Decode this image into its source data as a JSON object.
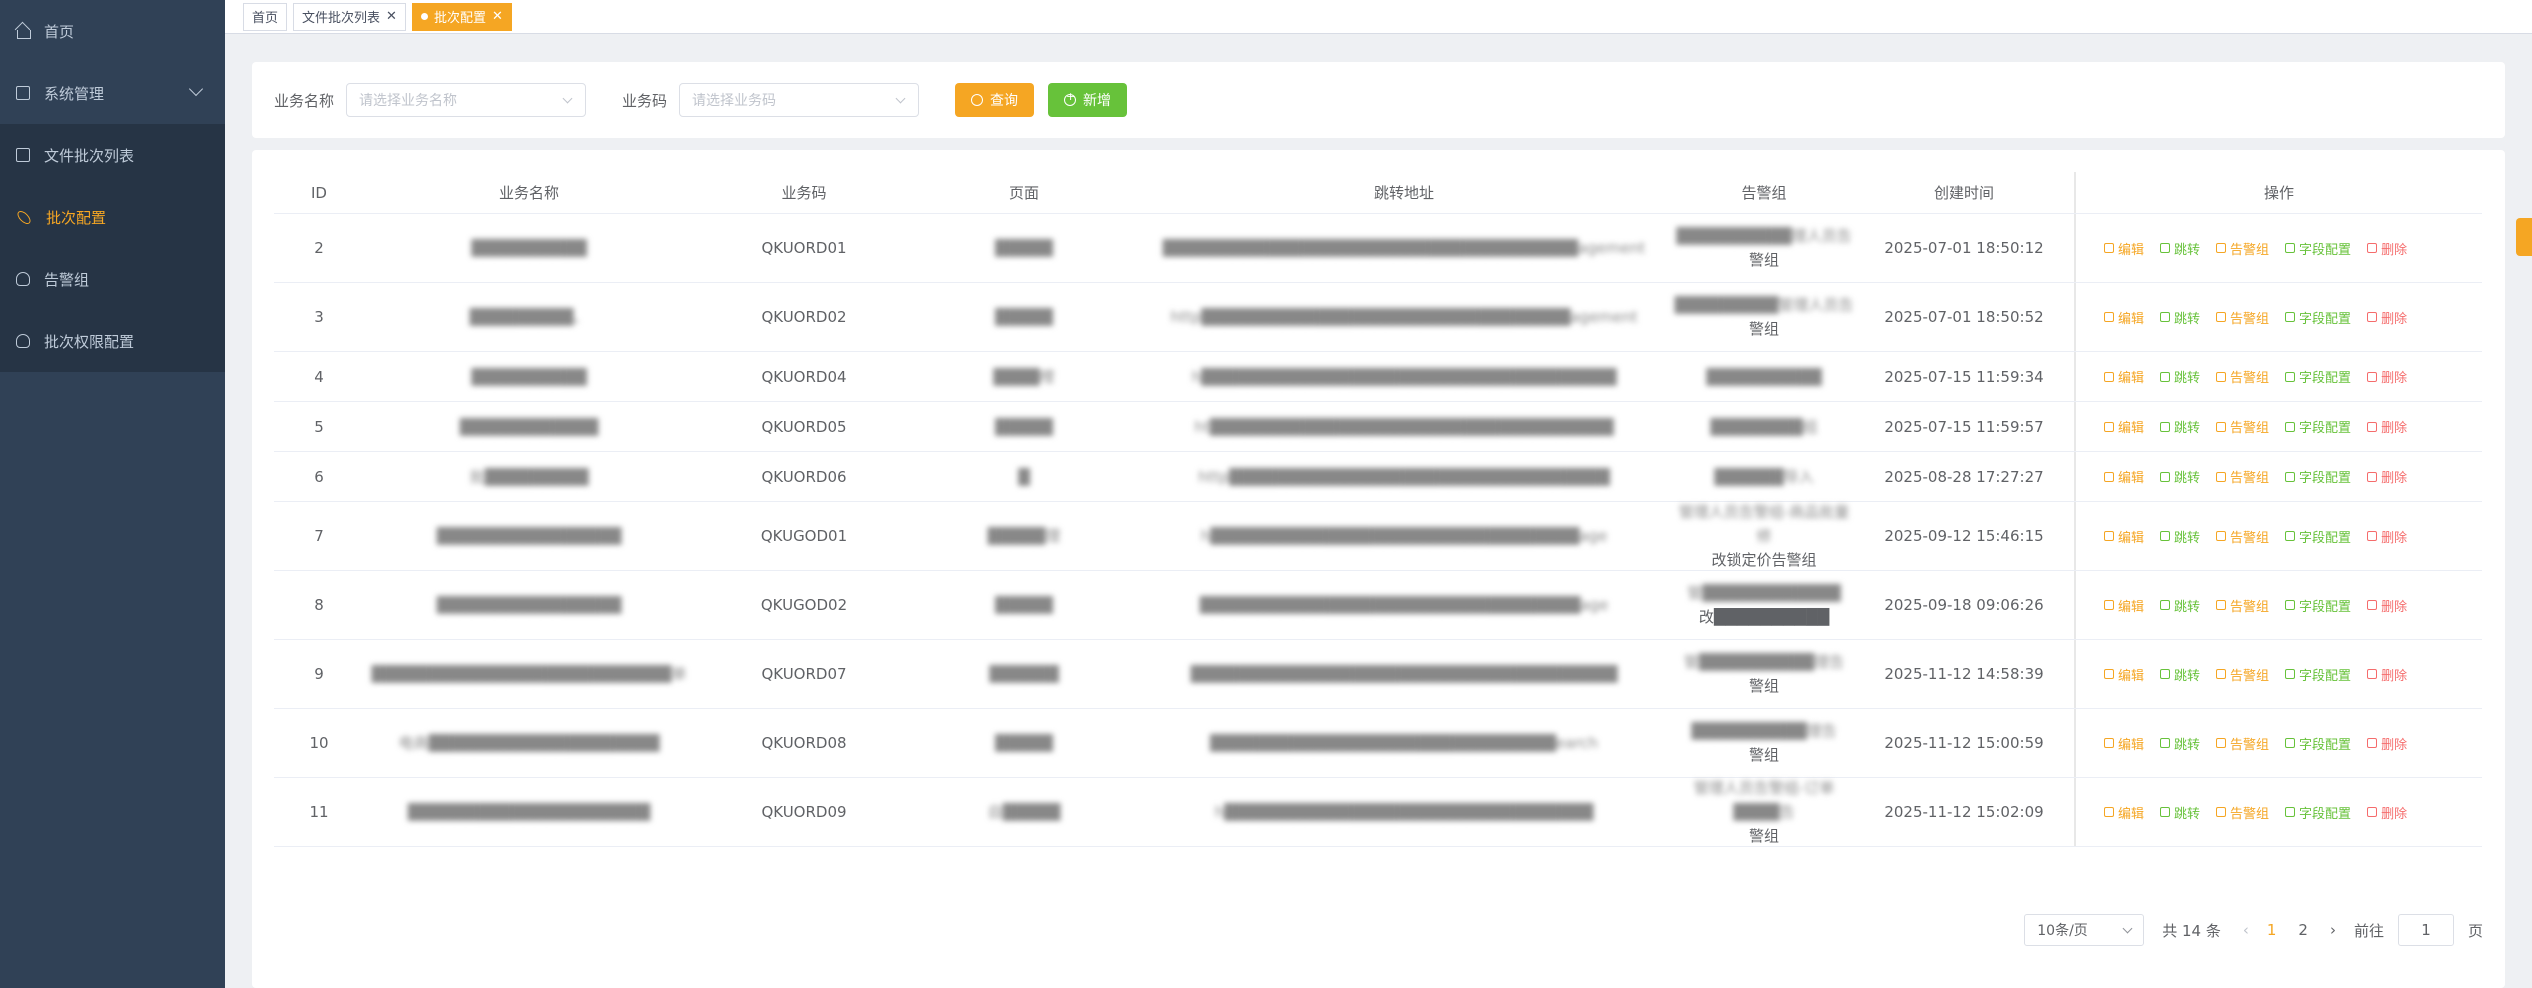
{
  "sidebar": {
    "items": [
      {
        "label": "首页"
      },
      {
        "label": "系统管理"
      },
      {
        "label": "文件批次列表"
      },
      {
        "label": "批次配置"
      },
      {
        "label": "告警组"
      },
      {
        "label": "批次权限配置"
      }
    ]
  },
  "tags": {
    "home": "首页",
    "file_batch": "文件批次列表",
    "batch_config": "批次配置",
    "close": "✕"
  },
  "search": {
    "name_label": "业务名称",
    "name_placeholder": "请选择业务名称",
    "code_label": "业务码",
    "code_placeholder": "请选择业务码",
    "query_btn": "查询",
    "add_btn": "新增"
  },
  "table": {
    "headers": {
      "id": "ID",
      "name": "业务名称",
      "code": "业务码",
      "page": "页面",
      "url": "跳转地址",
      "group": "告警组",
      "time": "创建时间",
      "ops": "操作"
    },
    "ops": {
      "edit": "编辑",
      "jump": "跳转",
      "alarm": "告警组",
      "field": "字段配置",
      "delete": "删除"
    },
    "rows": [
      {
        "id": "2",
        "name": "██████████",
        "code": "QKUORD01",
        "page": "█████",
        "url": "████████████████████████████████████agement",
        "group1": "██████████理人员告",
        "group2": "警组",
        "time": "2025-07-01 18:50:12"
      },
      {
        "id": "3",
        "name": "█████████、",
        "code": "QKUORD02",
        "page": "█████",
        "url": "http████████████████████████████████agement",
        "group1": "█████████管理人员告",
        "group2": "警组",
        "time": "2025-07-01 18:50:52"
      },
      {
        "id": "4",
        "name": "██████████",
        "code": "QKUORD04",
        "page": "████哩",
        "url": "h████████████████████████████████████",
        "group1": "██████████",
        "group2": "",
        "time": "2025-07-15 11:59:34"
      },
      {
        "id": "5",
        "name": "████████████",
        "code": "QKUORD05",
        "page": "█████",
        "url": "ht███████████████████████████████████",
        "group1": "████████组",
        "group2": "",
        "time": "2025-07-15 11:59:57"
      },
      {
        "id": "6",
        "name": "批█████████",
        "code": "QKUORD06",
        "page": "█",
        "url": "http█████████████████████████████████",
        "group1": "██████导入",
        "group2": "",
        "time": "2025-08-28 17:27:27"
      },
      {
        "id": "7",
        "name": "████████████████",
        "code": "QKUGOD01",
        "page": "█████理",
        "url": "h████████████████████████████████age",
        "group1": "管理人员告警组-商品批量修",
        "group2": "改锁定价告警组",
        "time": "2025-09-12 15:46:15"
      },
      {
        "id": "8",
        "name": "████████████████",
        "code": "QKUGOD02",
        "page": "█████",
        "url": "█████████████████████████████████age",
        "group1": "管████████████",
        "group2": "改██████████",
        "time": "2025-09-18 09:06:26"
      },
      {
        "id": "9",
        "name": "██████████████████████████单",
        "code": "QKUORD07",
        "page": "██████",
        "url": "█████████████████████████████████████",
        "group1": "管██████████理告",
        "group2": "警组",
        "time": "2025-11-12 14:58:39"
      },
      {
        "id": "10",
        "name": "电商████████████████████",
        "code": "QKUORD08",
        "page": "█████",
        "url": "██████████████████████████████earch",
        "group1": "██████████理告",
        "group2": "警组",
        "time": "2025-11-12 15:00:59"
      },
      {
        "id": "11",
        "name": "█████████████████████",
        "code": "QKUORD09",
        "page": "自█████",
        "url": "h████████████████████████████████",
        "group1": "管理人员告警组-订单████告",
        "group2": "警组",
        "time": "2025-11-12 15:02:09"
      }
    ]
  },
  "pager": {
    "size": "10条/页",
    "total": "共 14 条",
    "prev": "‹",
    "next": "›",
    "page1": "1",
    "page2": "2",
    "goto_label": "前往",
    "goto_value": "1",
    "page_suffix": "页"
  }
}
